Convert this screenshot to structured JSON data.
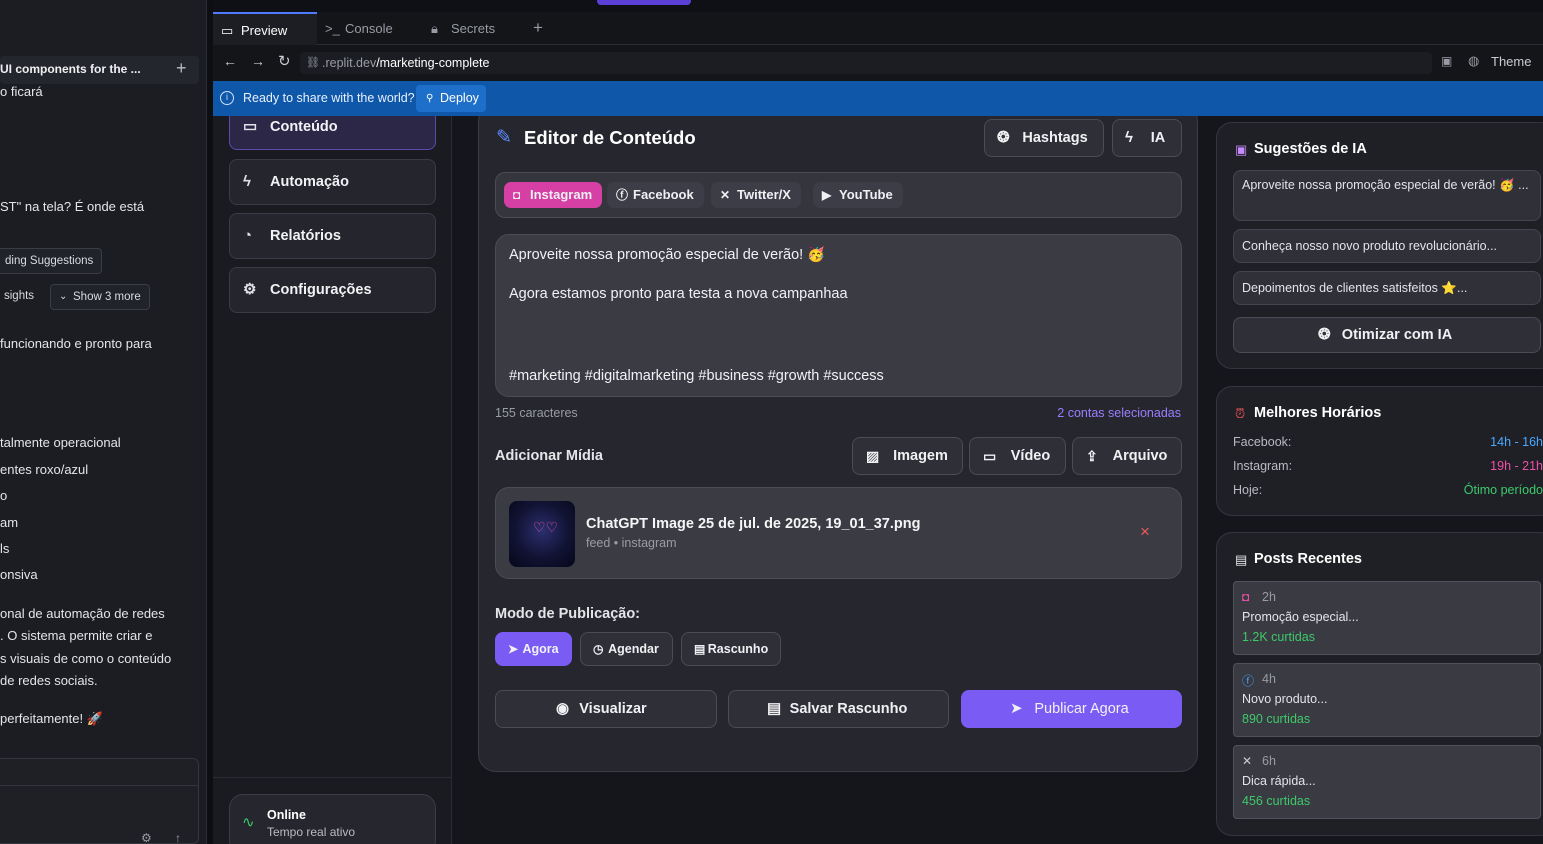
{
  "chat": {
    "header": "UI components for the ...",
    "lines": [
      "o ficará",
      "ST\" na tela? É onde está",
      "funcionando e pronto para",
      "talmente operacional",
      "entes roxo/azul",
      "o",
      "am",
      "ls",
      "onsiva",
      "onal de automação de redes",
      ". O sistema permite criar e",
      "s visuais de como o conteúdo",
      "de redes sociais.",
      "perfeitamente! 🚀"
    ],
    "chip_suggestions": "ding Suggestions",
    "chip_insights": "sights",
    "chip_more": "Show 3 more"
  },
  "workspace": {
    "tabs": [
      "Preview",
      "Console",
      "Secrets"
    ],
    "url_host": ".replit.dev",
    "url_path": "/marketing-complete",
    "theme_label": "Theme",
    "deploy_message": "Ready to share with the world?",
    "deploy_button": "Deploy"
  },
  "nav": {
    "items": [
      "Conteúdo",
      "Automação",
      "Relatórios",
      "Configurações"
    ],
    "status_title": "Online",
    "status_sub": "Tempo real ativo"
  },
  "editor": {
    "title": "Editor de Conteúdo",
    "hashtags_button": "Hashtags",
    "ai_button": "IA",
    "platforms": [
      "Instagram",
      "Facebook",
      "Twitter/X",
      "YouTube"
    ],
    "text_line1": "Aproveite nossa promoção especial de verão! 🥳",
    "text_line2": "Agora estamos pronto para testa a nova campanhaa",
    "text_hashtags": "#marketing #digitalmarketing #business #growth #success",
    "char_count": "155 caracteres",
    "accounts_selected": "2 contas selecionadas",
    "media_label": "Adicionar Mídia",
    "media_buttons": [
      "Imagem",
      "Vídeo",
      "Arquivo"
    ],
    "attachment_name": "ChatGPT Image 25 de jul. de 2025, 19_01_37.png",
    "attachment_meta": "feed • instagram",
    "mode_label": "Modo de Publicação:",
    "mode_options": [
      "Agora",
      "Agendar",
      "Rascunho"
    ],
    "preview_button": "Visualizar",
    "save_button": "Salvar Rascunho",
    "publish_button": "Publicar Agora"
  },
  "ai_suggestions": {
    "title": "Sugestões de IA",
    "items": [
      "Aproveite nossa promoção especial de verão! 🥳 ...",
      "Conheça nosso novo produto revolucionário...",
      "Depoimentos de clientes satisfeitos ⭐..."
    ],
    "optimize_button": "Otimizar com IA"
  },
  "best_times": {
    "title": "Melhores Horários",
    "rows": [
      {
        "label": "Facebook:",
        "value": "14h - 16h",
        "color": "#4aa8ff"
      },
      {
        "label": "Instagram:",
        "value": "19h - 21h",
        "color": "#f04fa8"
      },
      {
        "label": "Hoje:",
        "value": "Ótimo período",
        "color": "#3ec96a"
      }
    ]
  },
  "recent_posts": {
    "title": "Posts Recentes",
    "items": [
      {
        "platform": "instagram",
        "time": "2h",
        "text": "Promoção especial...",
        "likes": "1.2K curtidas"
      },
      {
        "platform": "facebook",
        "time": "4h",
        "text": "Novo produto...",
        "likes": "890 curtidas"
      },
      {
        "platform": "twitter",
        "time": "6h",
        "text": "Dica rápida...",
        "likes": "456 curtidas"
      }
    ]
  },
  "colors": {
    "accent": "#7a5cf5",
    "instagram": "#d63fa4",
    "green": "#3ec96a",
    "deploy_blue": "#0f57a8"
  }
}
